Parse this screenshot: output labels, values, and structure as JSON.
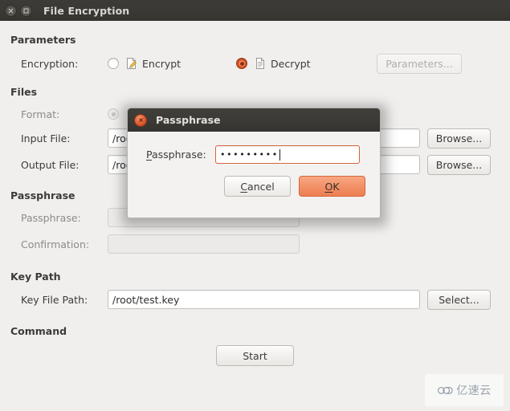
{
  "window": {
    "title": "File Encryption",
    "close_icon": "window-close-icon",
    "maximize_icon": "window-maximize-icon"
  },
  "sections": {
    "parameters": {
      "heading": "Parameters",
      "encryption_label": "Encryption:",
      "encrypt_option": "Encrypt",
      "encrypt_selected": false,
      "encrypt_icon": "document-pencil-icon",
      "decrypt_option": "Decrypt",
      "decrypt_selected": true,
      "decrypt_icon": "document-plain-icon",
      "parameters_button": "Parameters...",
      "parameters_button_disabled": true
    },
    "files": {
      "heading": "Files",
      "format_label": "Format:",
      "format_radio_disabled": true,
      "input_file_label": "Input File:",
      "input_file_value": "/root",
      "input_browse_button": "Browse...",
      "output_file_label": "Output File:",
      "output_file_value": "/root",
      "output_browse_button": "Browse..."
    },
    "passphrase": {
      "heading": "Passphrase",
      "passphrase_label": "Passphrase:",
      "passphrase_value": "",
      "passphrase_disabled": true,
      "confirmation_label": "Confirmation:",
      "confirmation_value": "",
      "confirmation_disabled": true
    },
    "key_path": {
      "heading": "Key Path",
      "key_file_label": "Key File Path:",
      "key_file_value": "/root/test.key",
      "select_button": "Select..."
    },
    "command": {
      "heading": "Command",
      "start_button": "Start"
    }
  },
  "dialog": {
    "title": "Passphrase",
    "close_icon": "dialog-close-icon",
    "field_label_prefix": "P",
    "field_label_rest": "assphrase:",
    "field_dots": "•••••••••",
    "cancel_prefix": "C",
    "cancel_rest": "ancel",
    "cancel_pre": "",
    "ok_prefix": "O",
    "ok_rest": "K"
  },
  "watermark": {
    "text": "亿速云",
    "icon": "cloud-icon"
  },
  "colors": {
    "accent": "#e8663a",
    "titlebar": "#3a3935",
    "background": "#f0efee",
    "focus_border": "#d4663a"
  }
}
